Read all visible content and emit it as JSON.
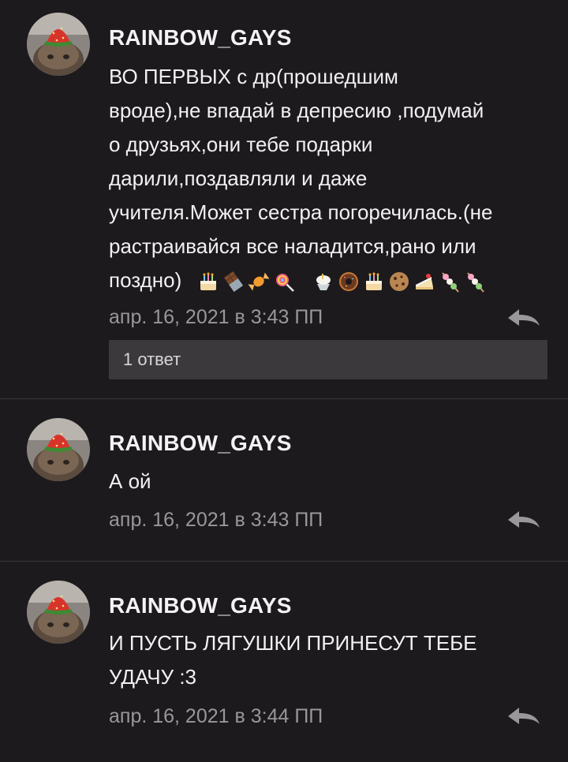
{
  "comments": [
    {
      "author": "RAINBOW_GAYS",
      "lines": [
        " ВО ПЕРВЫХ с др(прошедшим",
        "вроде),не впадай в депресию ,подумай",
        "о друзьях,они тебе подарки",
        "дарили,поздавляли и даже",
        "учителя.Может сестра погоречилась.(не",
        "растраивайся все наладится,рано или",
        "поздно)"
      ],
      "emojis": [
        "cake-emoji",
        "chocolate-emoji",
        "candy-emoji",
        "lollipop-emoji",
        "shaved-ice-emoji",
        "doughnut-emoji",
        "cake-emoji",
        "cookie-emoji",
        "shortcake-emoji",
        "dango-emoji",
        "dango-emoji"
      ],
      "timestamp": "апр. 16, 2021 в 3:43 ПП",
      "replies_label": "1 ответ"
    },
    {
      "author": "RAINBOW_GAYS",
      "lines": [
        "А ой"
      ],
      "timestamp": "апр. 16, 2021 в 3:43 ПП"
    },
    {
      "author": "RAINBOW_GAYS",
      "lines": [
        "И ПУСТЬ ЛЯГУШКИ ПРИНЕСУТ ТЕБЕ",
        "УДАЧУ :3"
      ],
      "timestamp": "апр. 16, 2021 в 3:44 ПП"
    }
  ],
  "icons": {
    "reply": "reply-arrow-icon",
    "avatar": "frog-with-strawberry-hat-avatar"
  },
  "colors": {
    "background": "#1c1a1d",
    "text": "#f2f0f2",
    "muted": "#9a979b",
    "button": "#3b393c",
    "divider": "#3a373b"
  }
}
